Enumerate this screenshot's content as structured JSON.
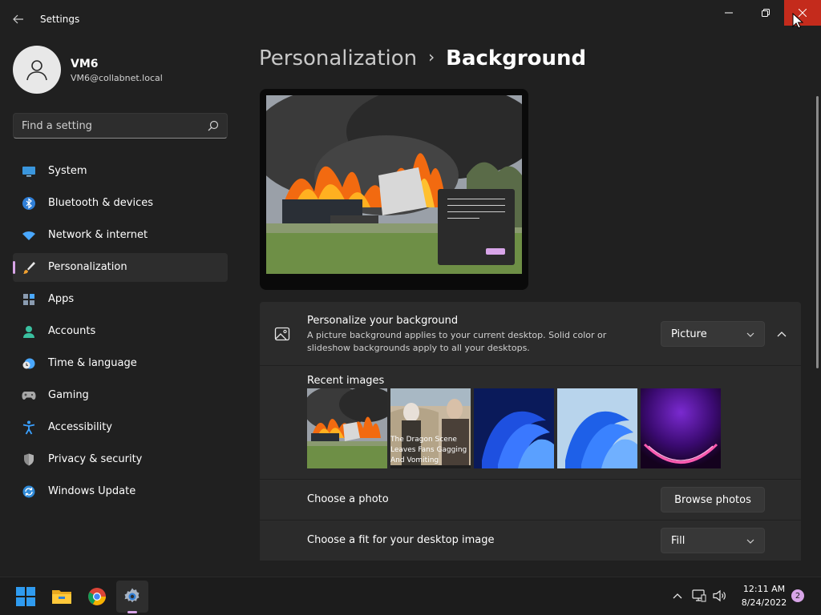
{
  "window": {
    "title": "Settings"
  },
  "user": {
    "name": "VM6",
    "email": "VM6@collabnet.local"
  },
  "search": {
    "placeholder": "Find a setting"
  },
  "sidebar": {
    "items": [
      {
        "label": "System",
        "icon": "monitor-icon"
      },
      {
        "label": "Bluetooth & devices",
        "icon": "bluetooth-icon"
      },
      {
        "label": "Network & internet",
        "icon": "wifi-icon"
      },
      {
        "label": "Personalization",
        "icon": "brush-icon",
        "selected": true
      },
      {
        "label": "Apps",
        "icon": "apps-icon"
      },
      {
        "label": "Accounts",
        "icon": "person-icon"
      },
      {
        "label": "Time & language",
        "icon": "clock-globe-icon"
      },
      {
        "label": "Gaming",
        "icon": "gamepad-icon"
      },
      {
        "label": "Accessibility",
        "icon": "accessibility-icon"
      },
      {
        "label": "Privacy & security",
        "icon": "shield-icon"
      },
      {
        "label": "Windows Update",
        "icon": "update-icon"
      }
    ]
  },
  "breadcrumb": {
    "parent": "Personalization",
    "current": "Background"
  },
  "background_section": {
    "title": "Personalize your background",
    "description": "A picture background applies to your current desktop. Solid color or slideshow backgrounds apply to all your desktops.",
    "type_value": "Picture",
    "recent_label": "Recent images",
    "thumbnail_caption": "The Dragon Scene Leaves Fans Gagging And Vomiting"
  },
  "choose_photo": {
    "label": "Choose a photo",
    "button": "Browse photos"
  },
  "choose_fit": {
    "label": "Choose a fit for your desktop image",
    "value": "Fill"
  },
  "taskbar": {
    "time": "12:11 AM",
    "date": "8/24/2022",
    "notifications": "2"
  },
  "colors": {
    "accent": "#d8a5e8",
    "close": "#c42b1c",
    "background": "#202020",
    "card": "#2b2b2b"
  }
}
